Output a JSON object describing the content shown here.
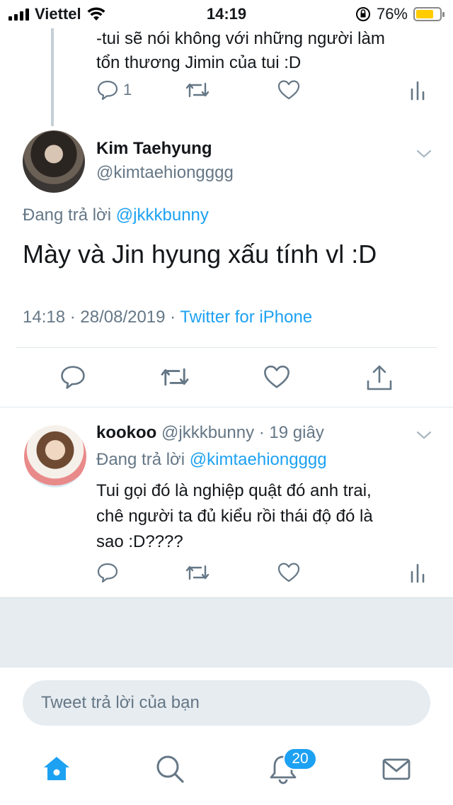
{
  "status_bar": {
    "carrier": "Viettel",
    "time": "14:19",
    "battery_percent": "76%",
    "battery_level": 0.76
  },
  "previous_tweet": {
    "text_line1": "-tui sẽ nói không với những người làm",
    "text_line2": "tổn thương Jimin của tui :D",
    "reply_count": "1"
  },
  "main_tweet": {
    "name": "Kim Taehyung",
    "handle": "@kimtaehiongggg",
    "replying_prefix": "Đang trả lời",
    "replying_to": "@jkkkbunny",
    "text": "Mày và Jin hyung xấu tính vl :D",
    "timestamp": "14:18 · 28/08/2019 ·",
    "source": "Twitter for iPhone"
  },
  "reply_tweet": {
    "name": "kookoo",
    "handle_time": "@jkkkbunny · 19 giây",
    "replying_prefix": "Đang trả lời",
    "replying_to": "@kimtaehiongggg",
    "text_line1": "Tui gọi đó là nghiệp quật đó anh trai,",
    "text_line2": "chê người ta đủ kiểu rồi thái độ đó là",
    "text_line3": "sao :D????"
  },
  "compose": {
    "placeholder": "Tweet trả lời của bạn"
  },
  "tab_bar": {
    "tabs": [
      "home-icon",
      "search-icon",
      "notifications-icon",
      "messages-icon"
    ],
    "notification_badge": "20"
  },
  "colors": {
    "accent": "#1da1f2",
    "secondary_text": "#657786",
    "background_gray": "#e6ecf0"
  }
}
